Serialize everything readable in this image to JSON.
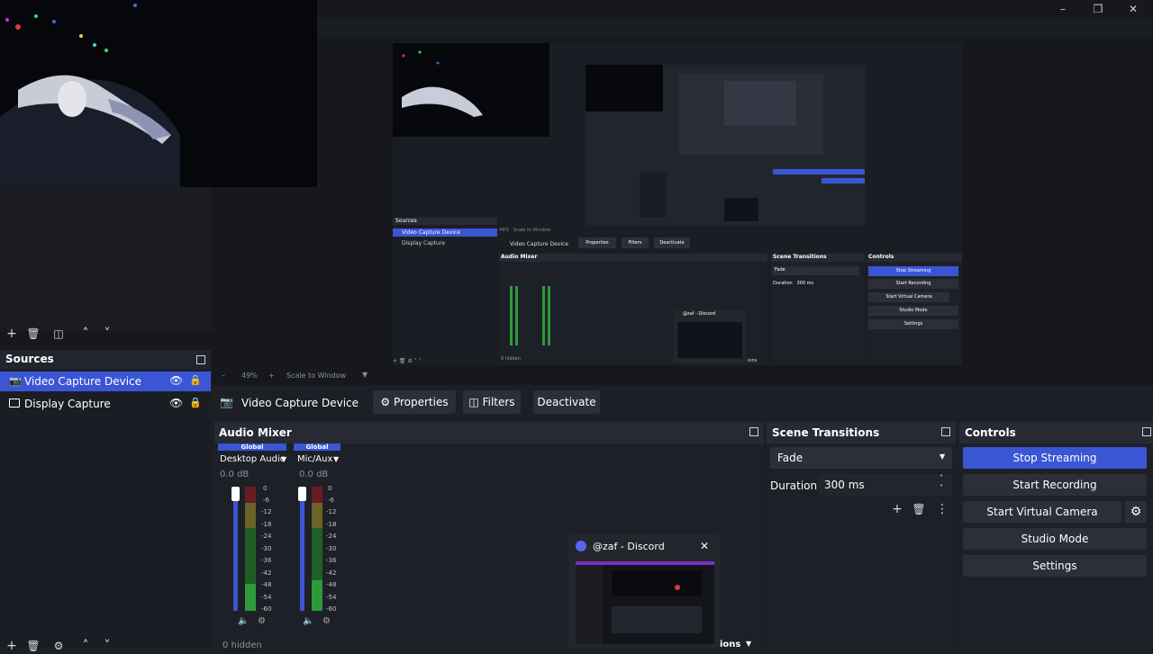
{
  "window": {
    "controls": [
      "minimize-icon",
      "restore-icon",
      "close-icon"
    ]
  },
  "preview": {
    "nested_zoom": "49%",
    "nested_scale_mode": "Scale to Window",
    "nested_sources_title": "Sources",
    "nested_source_1": "Video Capture Device",
    "nested_source_2": "Display Capture",
    "nested_audio_title": "Audio Mixer",
    "nested_transitions_title": "Scene Transitions",
    "nested_controls_title": "Controls",
    "nested_stop_streaming": "Stop Streaming",
    "nested_start_recording": "Start Recording",
    "nested_virtual_camera": "Start Virtual Camera",
    "nested_studio_mode": "Studio Mode",
    "nested_settings": "Settings",
    "nested_discord": "@zaf - Discord",
    "nested_fade": "Fade",
    "nested_duration_label": "Duration",
    "nested_duration_value": "300 ms",
    "nested_properties": "Properties",
    "nested_filters": "Filters",
    "nested_deactivate": "Deactivate",
    "nested_hidden": "0 hidden",
    "nested_tail": "ions"
  },
  "sources": {
    "title": "Sources",
    "items": [
      {
        "label": "Video Capture Device",
        "icon": "camera-icon",
        "selected": true
      },
      {
        "label": "Display Capture",
        "icon": "monitor-icon",
        "selected": false
      }
    ]
  },
  "source_bar": {
    "selected_source": "Video Capture Device",
    "properties_label": "Properties",
    "filters_label": "Filters",
    "deactivate_label": "Deactivate"
  },
  "audio_mixer": {
    "title": "Audio Mixer",
    "channels": [
      {
        "global": "Global",
        "name": "Desktop Audio",
        "level": "0.0 dB"
      },
      {
        "global": "Global",
        "name": "Mic/Aux",
        "level": "0.0 dB"
      }
    ],
    "scale": [
      "0",
      "-6",
      "-12",
      "-18",
      "-24",
      "-30",
      "-36",
      "-42",
      "-48",
      "-54",
      "-60"
    ],
    "hidden_count": "0 hidden"
  },
  "scene_transitions": {
    "title": "Scene Transitions",
    "transition": "Fade",
    "duration_label": "Duration",
    "duration_value": "300 ms"
  },
  "controls": {
    "title": "Controls",
    "stop_streaming": "Stop Streaming",
    "start_recording": "Start Recording",
    "start_virtual_camera": "Start Virtual Camera",
    "studio_mode": "Studio Mode",
    "settings": "Settings"
  },
  "discord_popup": {
    "title": "@zaf - Discord",
    "behind_text": "ions"
  },
  "colors": {
    "accent": "#3a56d4",
    "panel": "#1e2028",
    "header": "#272a33",
    "meter_green": "#2f9a3a",
    "meter_yellow": "#a59a2a",
    "meter_red": "#a02a2a"
  }
}
